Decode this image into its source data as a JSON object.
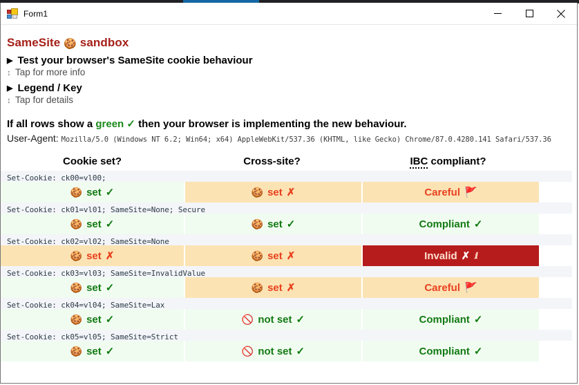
{
  "window": {
    "title": "Form1",
    "icon": "windows-form-icon",
    "controls": {
      "minimize": "minimize-icon",
      "maximize": "maximize-icon",
      "close": "close-icon"
    }
  },
  "page": {
    "brand_prefix": "SameSite",
    "brand_cookie_icon": "🍪",
    "brand_suffix": "sandbox",
    "brand_color": "#a52019",
    "sections": [
      {
        "marker": "▶",
        "title": "Test your browser's SameSite cookie behaviour",
        "hint_marker": "↕",
        "hint": "Tap for more info"
      },
      {
        "marker": "▶",
        "title": "Legend / Key",
        "hint_marker": "↕",
        "hint": "Tap for details"
      }
    ],
    "summary": {
      "pre": "If all rows show a ",
      "green_word": "green",
      "tick": "✓",
      "post": " then your browser is implementing the new behaviour.",
      "green_color": "#1a8a1a"
    },
    "user_agent": {
      "label": "User-Agent:",
      "value": "Mozilla/5.0 (Windows NT 6.2; Win64; x64) AppleWebKit/537.36 (KHTML, like Gecko) Chrome/87.0.4280.141 Safari/537.36"
    }
  },
  "table": {
    "headers": [
      "Cookie set?",
      "Cross-site?",
      "IBC compliant?"
    ],
    "header_abbr": "IBC",
    "header_abbr_rest": " compliant?",
    "rows": [
      {
        "set_cookie": "Set-Cookie: ck00=vl00;",
        "cells": [
          {
            "icon": "🍪",
            "label": "set",
            "mark": "✓",
            "mark_kind": "tick",
            "bg": "green",
            "text": "green"
          },
          {
            "icon": "🍪",
            "label": "set",
            "mark": "✗",
            "mark_kind": "x",
            "bg": "orange",
            "text": "red"
          },
          {
            "icon": "",
            "label": "Careful",
            "mark": "🚩",
            "mark_kind": "flag",
            "bg": "orange",
            "text": "red"
          }
        ]
      },
      {
        "set_cookie": "Set-Cookie: ck01=vl01; SameSite=None; Secure",
        "cells": [
          {
            "icon": "🍪",
            "label": "set",
            "mark": "✓",
            "mark_kind": "tick",
            "bg": "green",
            "text": "green"
          },
          {
            "icon": "🍪",
            "label": "set",
            "mark": "✓",
            "mark_kind": "tick",
            "bg": "green",
            "text": "green"
          },
          {
            "icon": "",
            "label": "Compliant",
            "mark": "✓",
            "mark_kind": "tick",
            "bg": "green",
            "text": "green"
          }
        ]
      },
      {
        "set_cookie": "Set-Cookie: ck02=vl02; SameSite=None",
        "cells": [
          {
            "icon": "🍪",
            "label": "set",
            "mark": "✗",
            "mark_kind": "x",
            "bg": "orange",
            "text": "red"
          },
          {
            "icon": "🍪",
            "label": "set",
            "mark": "✗",
            "mark_kind": "x",
            "bg": "orange",
            "text": "red"
          },
          {
            "icon": "",
            "label": "Invalid",
            "mark": "✗",
            "mark_kind": "x-white",
            "info": "ℹ",
            "bg": "red",
            "text": "white"
          }
        ]
      },
      {
        "set_cookie": "Set-Cookie: ck03=vl03; SameSite=InvalidValue",
        "cells": [
          {
            "icon": "🍪",
            "label": "set",
            "mark": "✓",
            "mark_kind": "tick",
            "bg": "green",
            "text": "green"
          },
          {
            "icon": "🍪",
            "label": "set",
            "mark": "✗",
            "mark_kind": "x",
            "bg": "orange",
            "text": "red"
          },
          {
            "icon": "",
            "label": "Careful",
            "mark": "🚩",
            "mark_kind": "flag",
            "bg": "orange",
            "text": "red"
          }
        ]
      },
      {
        "set_cookie": "Set-Cookie: ck04=vl04; SameSite=Lax",
        "cells": [
          {
            "icon": "🍪",
            "label": "set",
            "mark": "✓",
            "mark_kind": "tick",
            "bg": "green",
            "text": "green"
          },
          {
            "icon": "🚫",
            "label": "not set",
            "mark": "✓",
            "mark_kind": "tick",
            "bg": "green",
            "text": "green"
          },
          {
            "icon": "",
            "label": "Compliant",
            "mark": "✓",
            "mark_kind": "tick",
            "bg": "green",
            "text": "green"
          }
        ]
      },
      {
        "set_cookie": "Set-Cookie: ck05=vl05; SameSite=Strict",
        "cells": [
          {
            "icon": "🍪",
            "label": "set",
            "mark": "✓",
            "mark_kind": "tick",
            "bg": "green",
            "text": "green"
          },
          {
            "icon": "🚫",
            "label": "not set",
            "mark": "✓",
            "mark_kind": "tick",
            "bg": "green",
            "text": "green"
          },
          {
            "icon": "",
            "label": "Compliant",
            "mark": "✓",
            "mark_kind": "tick",
            "bg": "green",
            "text": "green"
          }
        ]
      }
    ]
  },
  "colors": {
    "bg_green": "#f1fcf1",
    "bg_orange": "#fce3b4",
    "bg_red": "#b71c1c",
    "setcookie_bg": "#f3f5f9",
    "text_green": "#137a13",
    "text_red": "#e8411e"
  }
}
